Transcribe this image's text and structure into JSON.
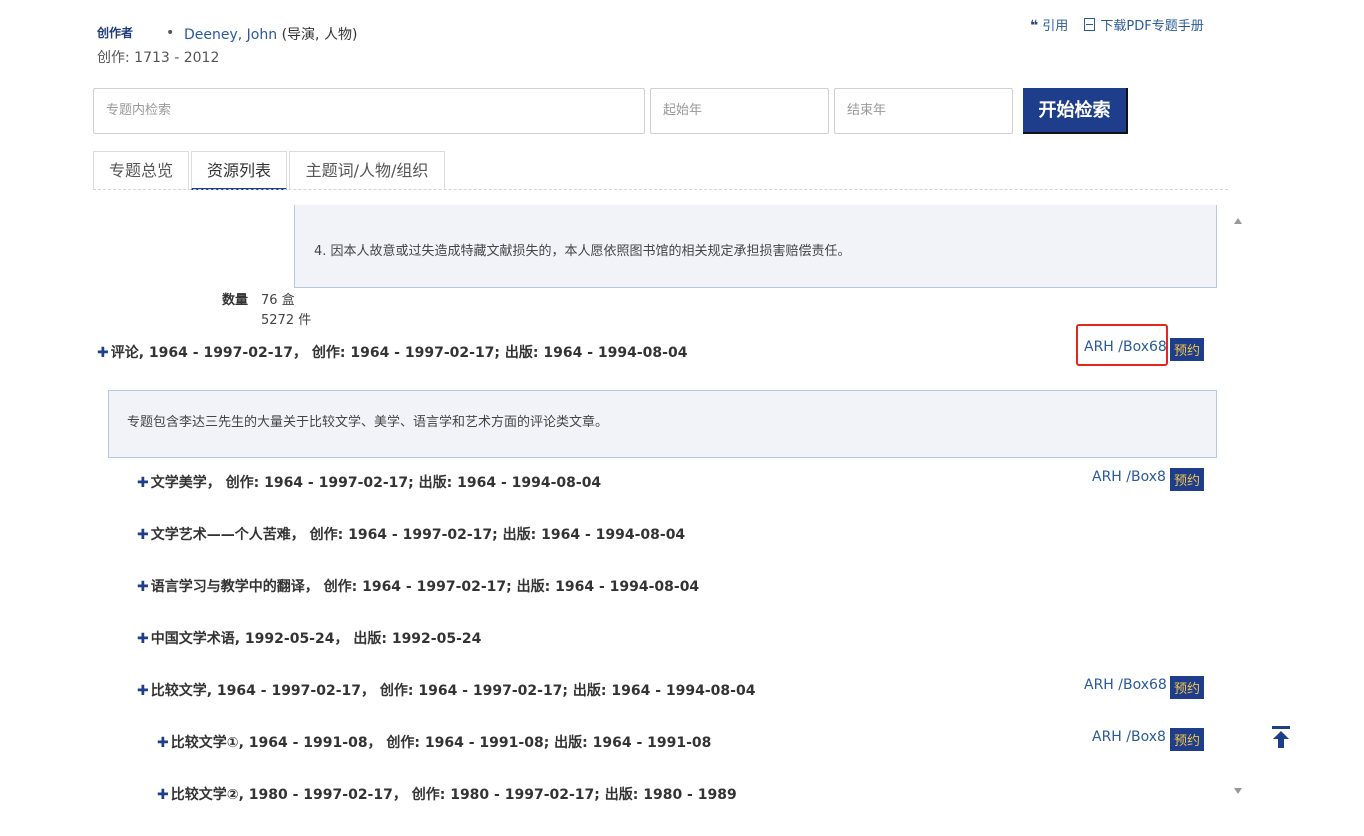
{
  "header": {
    "creator_label": "创作者",
    "creator_name": "Deeney, John",
    "creator_roles": "(导演, 人物)",
    "creation_dates": "创作: 1713 - 2012"
  },
  "top_actions": {
    "cite": "引用",
    "download_pdf": "下载PDF专题手册"
  },
  "search": {
    "keyword_placeholder": "专题内检索",
    "start_year_placeholder": "起始年",
    "end_year_placeholder": "结束年",
    "button_label": "开始检索"
  },
  "tabs": [
    {
      "label": "专题总览"
    },
    {
      "label": "资源列表"
    },
    {
      "label": "主题词/人物/组织"
    }
  ],
  "content": {
    "notice_text": "4. 因本人故意或过失造成特藏文献损失的，本人愿依照图书馆的相关规定承担损害赔偿责任。",
    "quantity_label": "数量",
    "quantity_boxes": "76 盒",
    "quantity_items": "5272 件",
    "series": {
      "title": "评论, 1964 - 1997-02-17， 创作: 1964 - 1997-02-17; 出版: 1964 - 1994-08-04",
      "location": "ARH /Box68",
      "reserve": "预约",
      "scope_note": "专题包含李达三先生的大量关于比较文学、美学、语言学和艺术方面的评论类文章。"
    },
    "items": [
      {
        "title": "文学美学， 创作: 1964 - 1997-02-17; 出版: 1964 - 1994-08-04",
        "location": "ARH /Box8",
        "reserve": "预约"
      },
      {
        "title": "文学艺术——个人苦难， 创作: 1964 - 1997-02-17; 出版: 1964 - 1994-08-04"
      },
      {
        "title": "语言学习与教学中的翻译， 创作: 1964 - 1997-02-17; 出版: 1964 - 1994-08-04"
      },
      {
        "title": "中国文学术语, 1992-05-24， 出版: 1992-05-24"
      },
      {
        "title": "比较文学, 1964 - 1997-02-17， 创作: 1964 - 1997-02-17; 出版: 1964 - 1994-08-04",
        "location": "ARH /Box68",
        "reserve": "预约"
      },
      {
        "title": "比较文学①, 1964 - 1991-08， 创作: 1964 - 1991-08; 出版: 1964 - 1991-08",
        "location": "ARH /Box8",
        "reserve": "预约"
      },
      {
        "title": "比较文学②, 1980 - 1997-02-17， 创作: 1980 - 1997-02-17; 出版: 1980 - 1989"
      }
    ]
  },
  "icons": {
    "cite": "quote-icon",
    "pdf": "file-icon",
    "expand": "plus-icon",
    "back_to_top": "arrow-up-to-top-icon"
  },
  "colors": {
    "primary": "#1e3d8a",
    "link": "#2a5a9a",
    "reserve_text": "#f2c64b",
    "highlight": "#e5261b",
    "panel_bg": "#f1f3f9"
  }
}
